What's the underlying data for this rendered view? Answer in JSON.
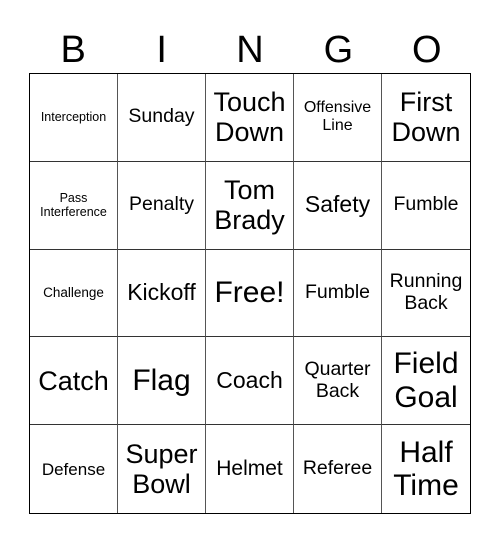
{
  "header": [
    "B",
    "I",
    "N",
    "G",
    "O"
  ],
  "cells": [
    [
      "Interception",
      "Sunday",
      "Touch Down",
      "Offensive Line",
      "First Down"
    ],
    [
      "Pass Interference",
      "Penalty",
      "Tom Brady",
      "Safety",
      "Fumble"
    ],
    [
      "Challenge",
      "Kickoff",
      "Free!",
      "Fumble",
      "Running Back"
    ],
    [
      "Catch",
      "Flag",
      "Coach",
      "Quarter Back",
      "Field Goal"
    ],
    [
      "Defense",
      "Super Bowl",
      "Helmet",
      "Referee",
      "Half Time"
    ]
  ]
}
